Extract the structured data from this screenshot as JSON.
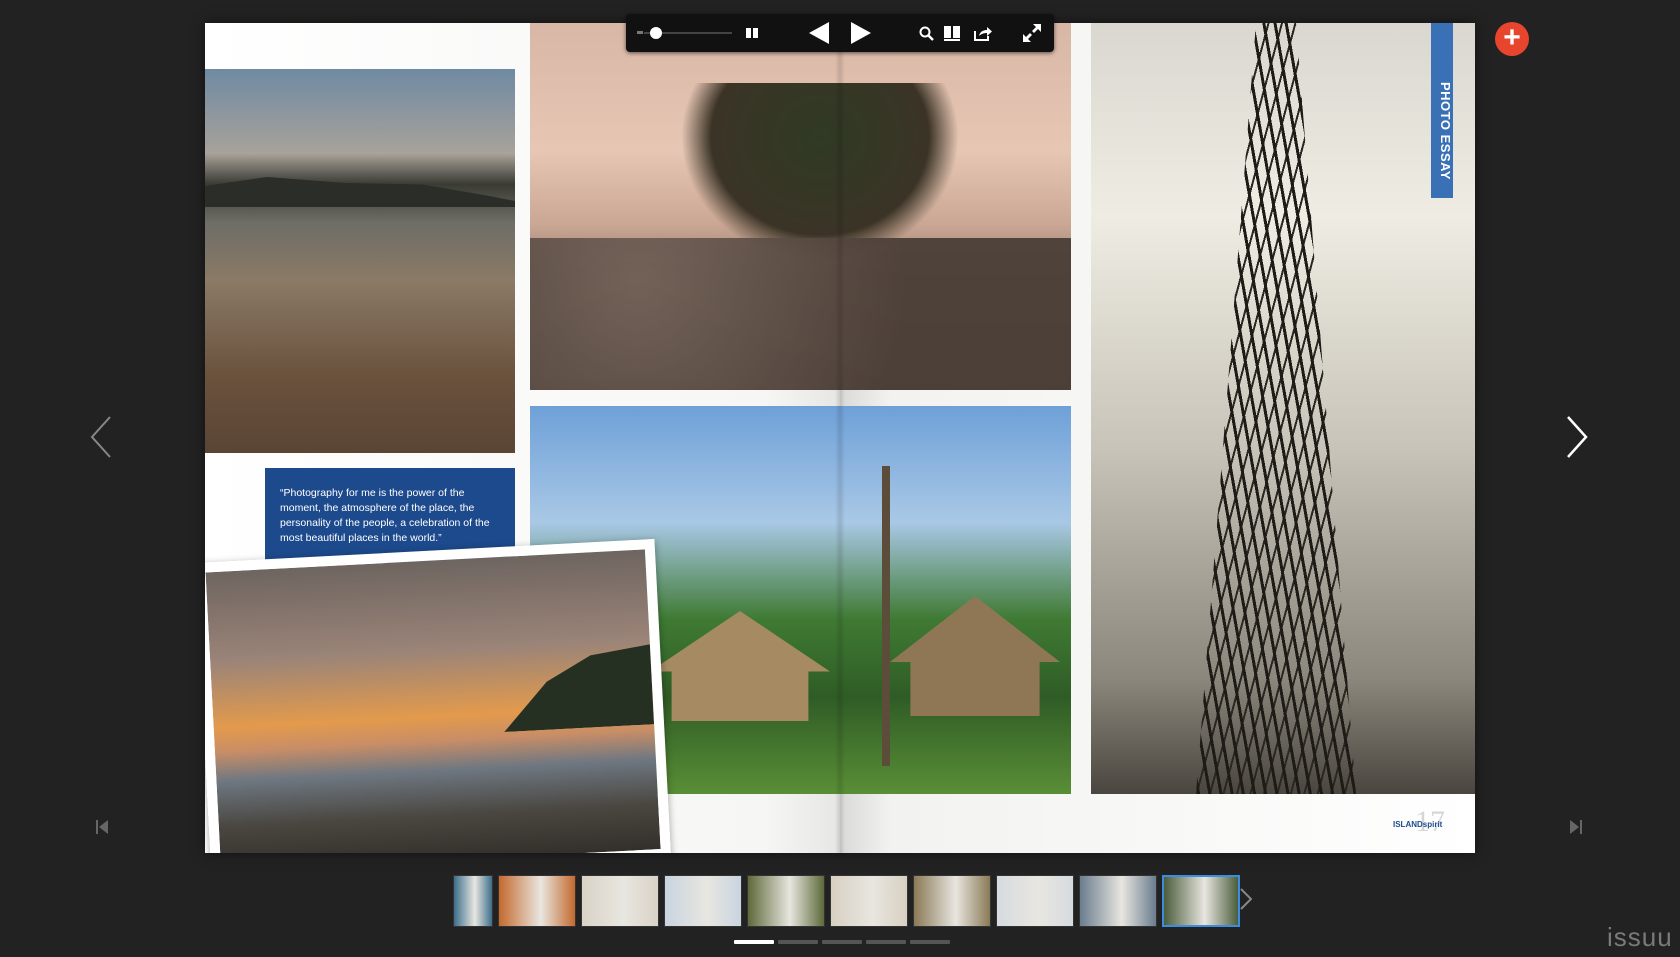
{
  "viewer": {
    "brand": "issuu",
    "plus_label": "+",
    "icons": {
      "prev_page": "chevron-left-icon",
      "next_page": "chevron-right-icon",
      "first_page": "skip-first-icon",
      "last_page": "skip-last-icon"
    }
  },
  "toolbar": {
    "zoom_level": 0.1,
    "icons": [
      "zoom-slider",
      "pause-icon",
      "previous-triangle-icon",
      "play-icon",
      "search-icon",
      "pages-icon",
      "share-icon",
      "fullscreen-icon"
    ]
  },
  "spread": {
    "quote": "“Photography for me is the power of the moment, the atmosphere of the place, the personality of the people, a celebration of the most beautiful places in the world.”",
    "section_tab": "PHOTO ESSAY",
    "footer_logo": "ISLANDspirit",
    "page_number": "17"
  },
  "thumbnails": {
    "count": 10,
    "active_index": 9,
    "widths": [
      40,
      78,
      78,
      78,
      78,
      78,
      78,
      78,
      78,
      78
    ],
    "colors": [
      "#3c6e8a",
      "#c46a2e",
      "#d9d2c6",
      "#c9d4e0",
      "#5e6a3a",
      "#d8d0c2",
      "#8a7a56",
      "#d6dbe0",
      "#6a7d8f",
      "#4b5d3c"
    ]
  },
  "pager": {
    "pages": 5,
    "active": 0
  },
  "colors": {
    "background": "#222222",
    "accent_red": "#e8452e",
    "quote_blue": "#1d4a8c",
    "tab_blue": "#3a70b5",
    "active_thumb": "#3b8de0"
  }
}
